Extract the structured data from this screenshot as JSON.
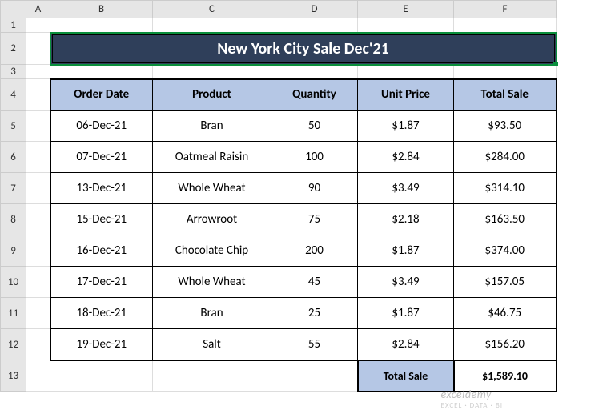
{
  "columns": [
    "A",
    "B",
    "C",
    "D",
    "E",
    "F"
  ],
  "rows": [
    "1",
    "2",
    "3",
    "4",
    "5",
    "6",
    "7",
    "8",
    "9",
    "10",
    "11",
    "12",
    "13"
  ],
  "title": "New York City Sale Dec'21",
  "headers": {
    "order_date": "Order Date",
    "product": "Product",
    "quantity": "Quantity",
    "unit_price": "Unit Price",
    "total_sale": "Total Sale"
  },
  "data": [
    {
      "date": "06-Dec-21",
      "product": "Bran",
      "qty": "50",
      "price": "$1.87",
      "total": "$93.50"
    },
    {
      "date": "07-Dec-21",
      "product": "Oatmeal Raisin",
      "qty": "100",
      "price": "$2.84",
      "total": "$284.00"
    },
    {
      "date": "13-Dec-21",
      "product": "Whole Wheat",
      "qty": "90",
      "price": "$3.49",
      "total": "$314.10"
    },
    {
      "date": "15-Dec-21",
      "product": "Arrowroot",
      "qty": "75",
      "price": "$2.18",
      "total": "$163.50"
    },
    {
      "date": "16-Dec-21",
      "product": "Chocolate Chip",
      "qty": "200",
      "price": "$1.87",
      "total": "$374.00"
    },
    {
      "date": "17-Dec-21",
      "product": "Whole Wheat",
      "qty": "45",
      "price": "$3.49",
      "total": "$157.05"
    },
    {
      "date": "18-Dec-21",
      "product": "Bran",
      "qty": "25",
      "price": "$1.87",
      "total": "$46.75"
    },
    {
      "date": "19-Dec-21",
      "product": "Salt",
      "qty": "55",
      "price": "$2.84",
      "total": "$156.20"
    }
  ],
  "footer": {
    "label": "Total Sale",
    "value": "$1,589.10"
  },
  "watermark": {
    "brand": "exceldemy",
    "tag": "EXCEL · DATA · BI"
  },
  "chart_data": {
    "type": "table",
    "title": "New York City Sale Dec'21",
    "columns": [
      "Order Date",
      "Product",
      "Quantity",
      "Unit Price",
      "Total Sale"
    ],
    "rows": [
      [
        "06-Dec-21",
        "Bran",
        50,
        1.87,
        93.5
      ],
      [
        "07-Dec-21",
        "Oatmeal Raisin",
        100,
        2.84,
        284.0
      ],
      [
        "13-Dec-21",
        "Whole Wheat",
        90,
        3.49,
        314.1
      ],
      [
        "15-Dec-21",
        "Arrowroot",
        75,
        2.18,
        163.5
      ],
      [
        "16-Dec-21",
        "Chocolate Chip",
        200,
        1.87,
        374.0
      ],
      [
        "17-Dec-21",
        "Whole Wheat",
        45,
        3.49,
        157.05
      ],
      [
        "18-Dec-21",
        "Bran",
        25,
        1.87,
        46.75
      ],
      [
        "19-Dec-21",
        "Salt",
        55,
        2.84,
        156.2
      ]
    ],
    "footer": {
      "label": "Total Sale",
      "value": 1589.1
    }
  }
}
